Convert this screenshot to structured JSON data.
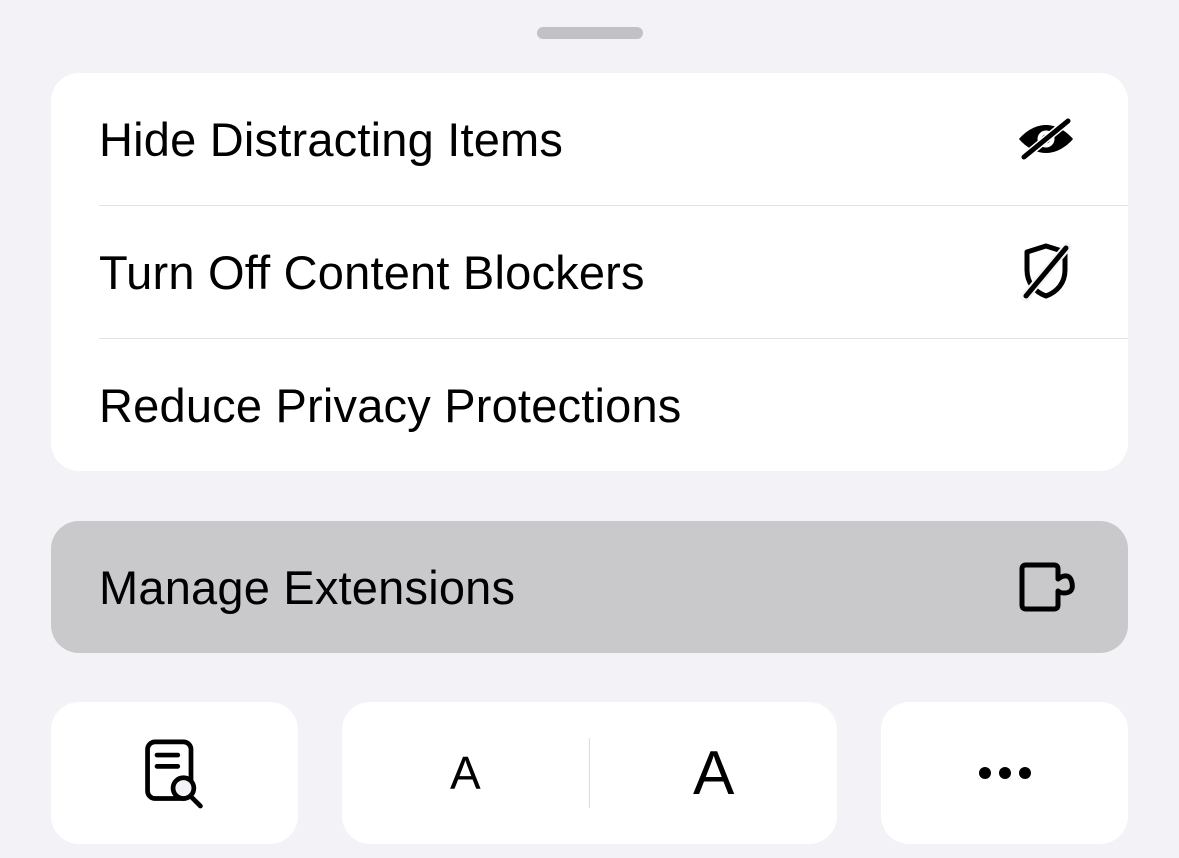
{
  "menu": {
    "items": [
      {
        "label": "Hide Distracting Items",
        "icon": "eye-slash-icon"
      },
      {
        "label": "Turn Off Content Blockers",
        "icon": "shield-slash-icon"
      },
      {
        "label": "Reduce Privacy Protections",
        "icon": ""
      }
    ]
  },
  "extensions": {
    "label": "Manage Extensions",
    "icon": "puzzle-icon"
  },
  "toolbar": {
    "reader_icon": "reader-search-icon",
    "text_small": "A",
    "text_large": "A",
    "more_icon": "ellipsis-icon"
  }
}
